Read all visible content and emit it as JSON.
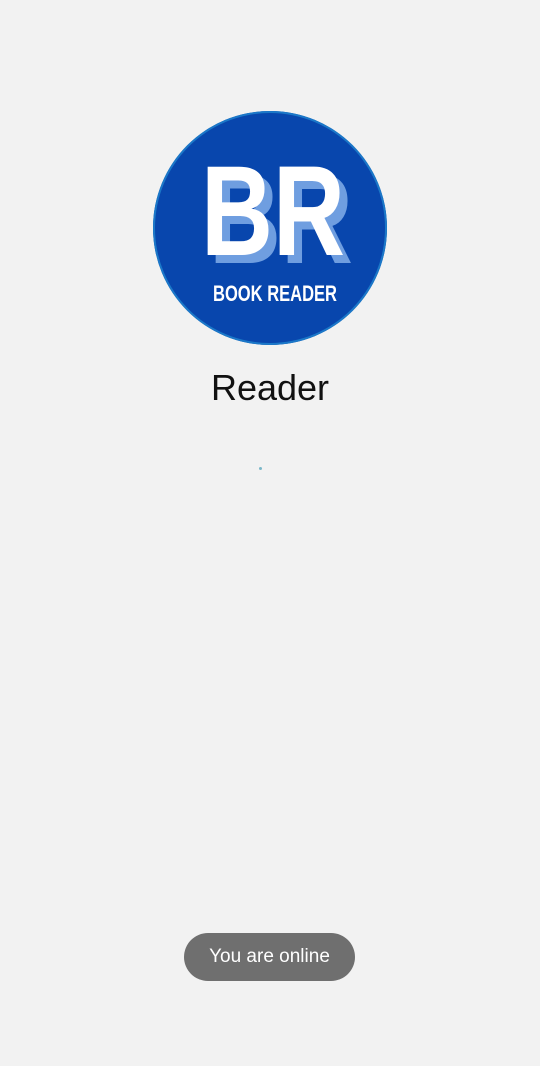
{
  "splash": {
    "logo_monogram": "BR",
    "logo_text": "BOOK READER",
    "app_name": "Reader",
    "spinner_icon": "loading-spinner-icon"
  },
  "toast": {
    "message": "You are online"
  },
  "colors": {
    "background": "#f2f2f2",
    "logo_blue": "#0846ad",
    "logo_shadow": "#6f9ee0",
    "toast_bg": "#6f6f6f"
  }
}
